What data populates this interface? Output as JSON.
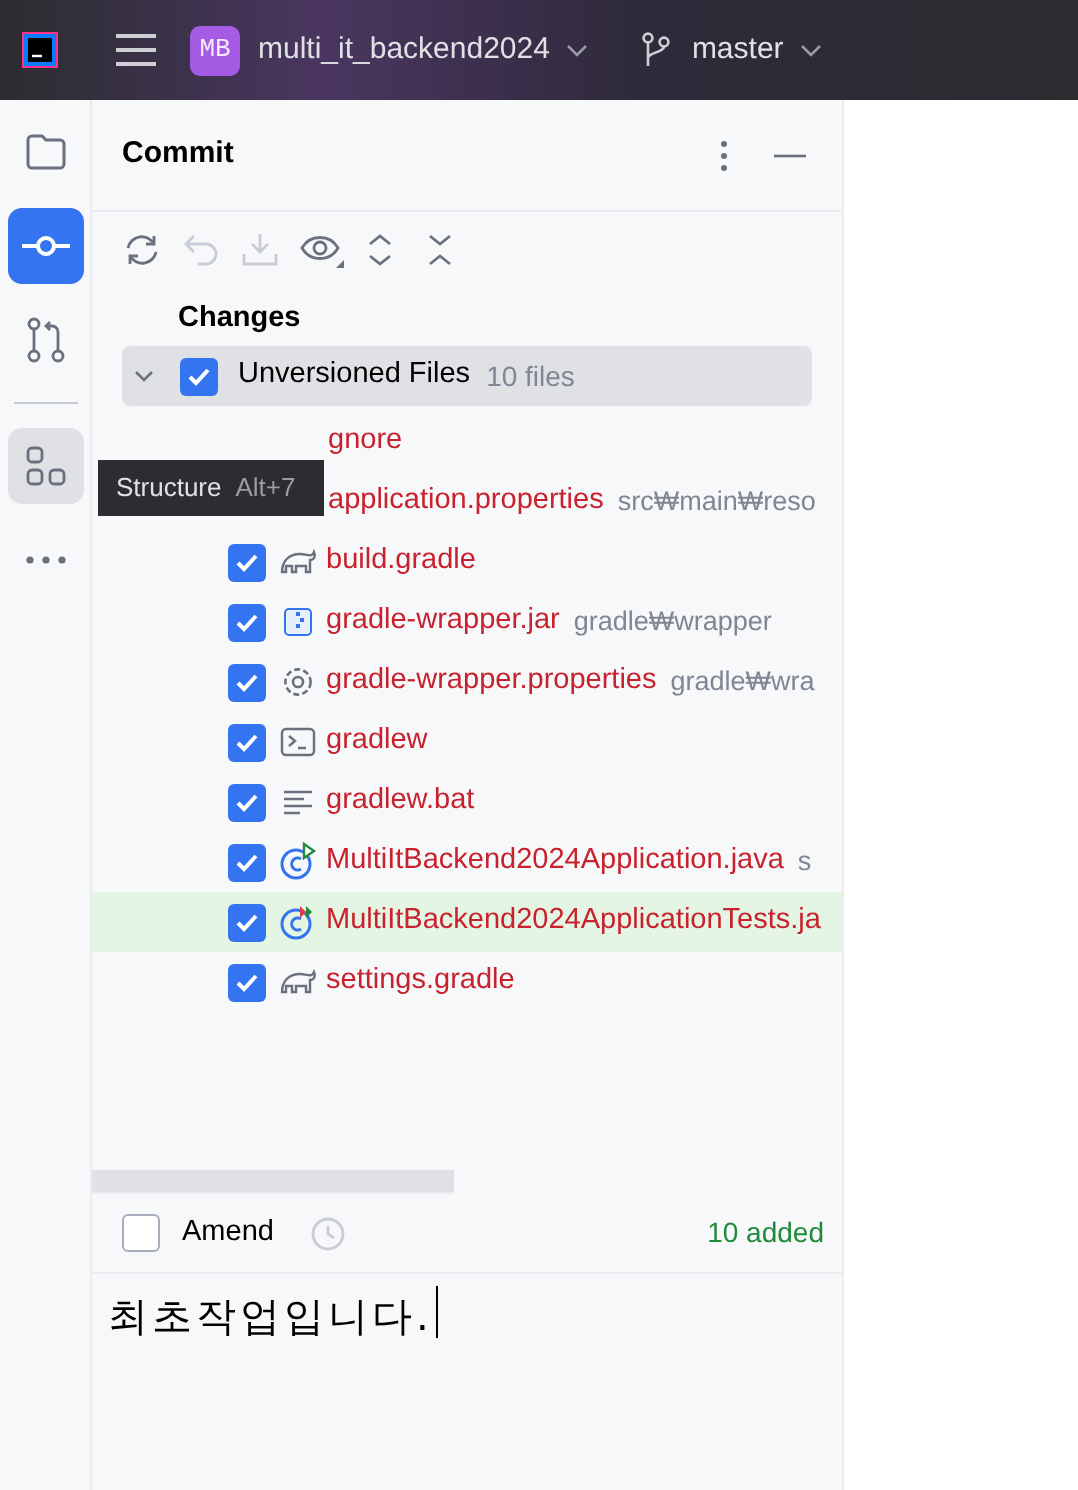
{
  "title_bar": {
    "project_badge": "MB",
    "project": "multi_it_backend2024",
    "branch": "master"
  },
  "sidebar": {
    "items": [
      {
        "kind": "folder",
        "selected": false
      },
      {
        "kind": "commit",
        "selected": true
      },
      {
        "kind": "pull",
        "selected": false
      },
      {
        "kind": "structure",
        "selected": false
      },
      {
        "kind": "more",
        "selected": false
      }
    ]
  },
  "panel": {
    "title": "Commit",
    "section": "Changes",
    "group": {
      "label": "Unversioned Files",
      "count": "10 files",
      "checked": true,
      "expanded": true
    },
    "files": [
      {
        "kind": "covered",
        "name": "gnore"
      },
      {
        "kind": "covered",
        "name": "application.properties",
        "path": "src₩main₩reso"
      },
      {
        "kind": "gradle",
        "name": "build.gradle",
        "checked": true,
        "selected": false
      },
      {
        "kind": "archive",
        "name": "gradle-wrapper.jar",
        "path": "gradle₩wrapper",
        "checked": true,
        "selected": false
      },
      {
        "kind": "config",
        "name": "gradle-wrapper.properties",
        "path": "gradle₩wra",
        "checked": true,
        "selected": false
      },
      {
        "kind": "script",
        "name": "gradlew",
        "checked": true,
        "selected": false
      },
      {
        "kind": "text",
        "name": "gradlew.bat",
        "checked": true,
        "selected": false
      },
      {
        "kind": "runnable",
        "name": "MultiItBackend2024Application.java",
        "path": "s",
        "checked": true,
        "selected": false
      },
      {
        "kind": "test",
        "name": "MultiItBackend2024ApplicationTests.ja",
        "checked": true,
        "selected": true
      },
      {
        "kind": "gradle",
        "name": "settings.gradle",
        "checked": true,
        "selected": false
      }
    ],
    "amend": {
      "label": "Amend",
      "checked": false
    },
    "summary": "10 added",
    "message": "최초작업입니다."
  },
  "tooltip": {
    "label": "Structure",
    "shortcut": "Alt+7"
  }
}
